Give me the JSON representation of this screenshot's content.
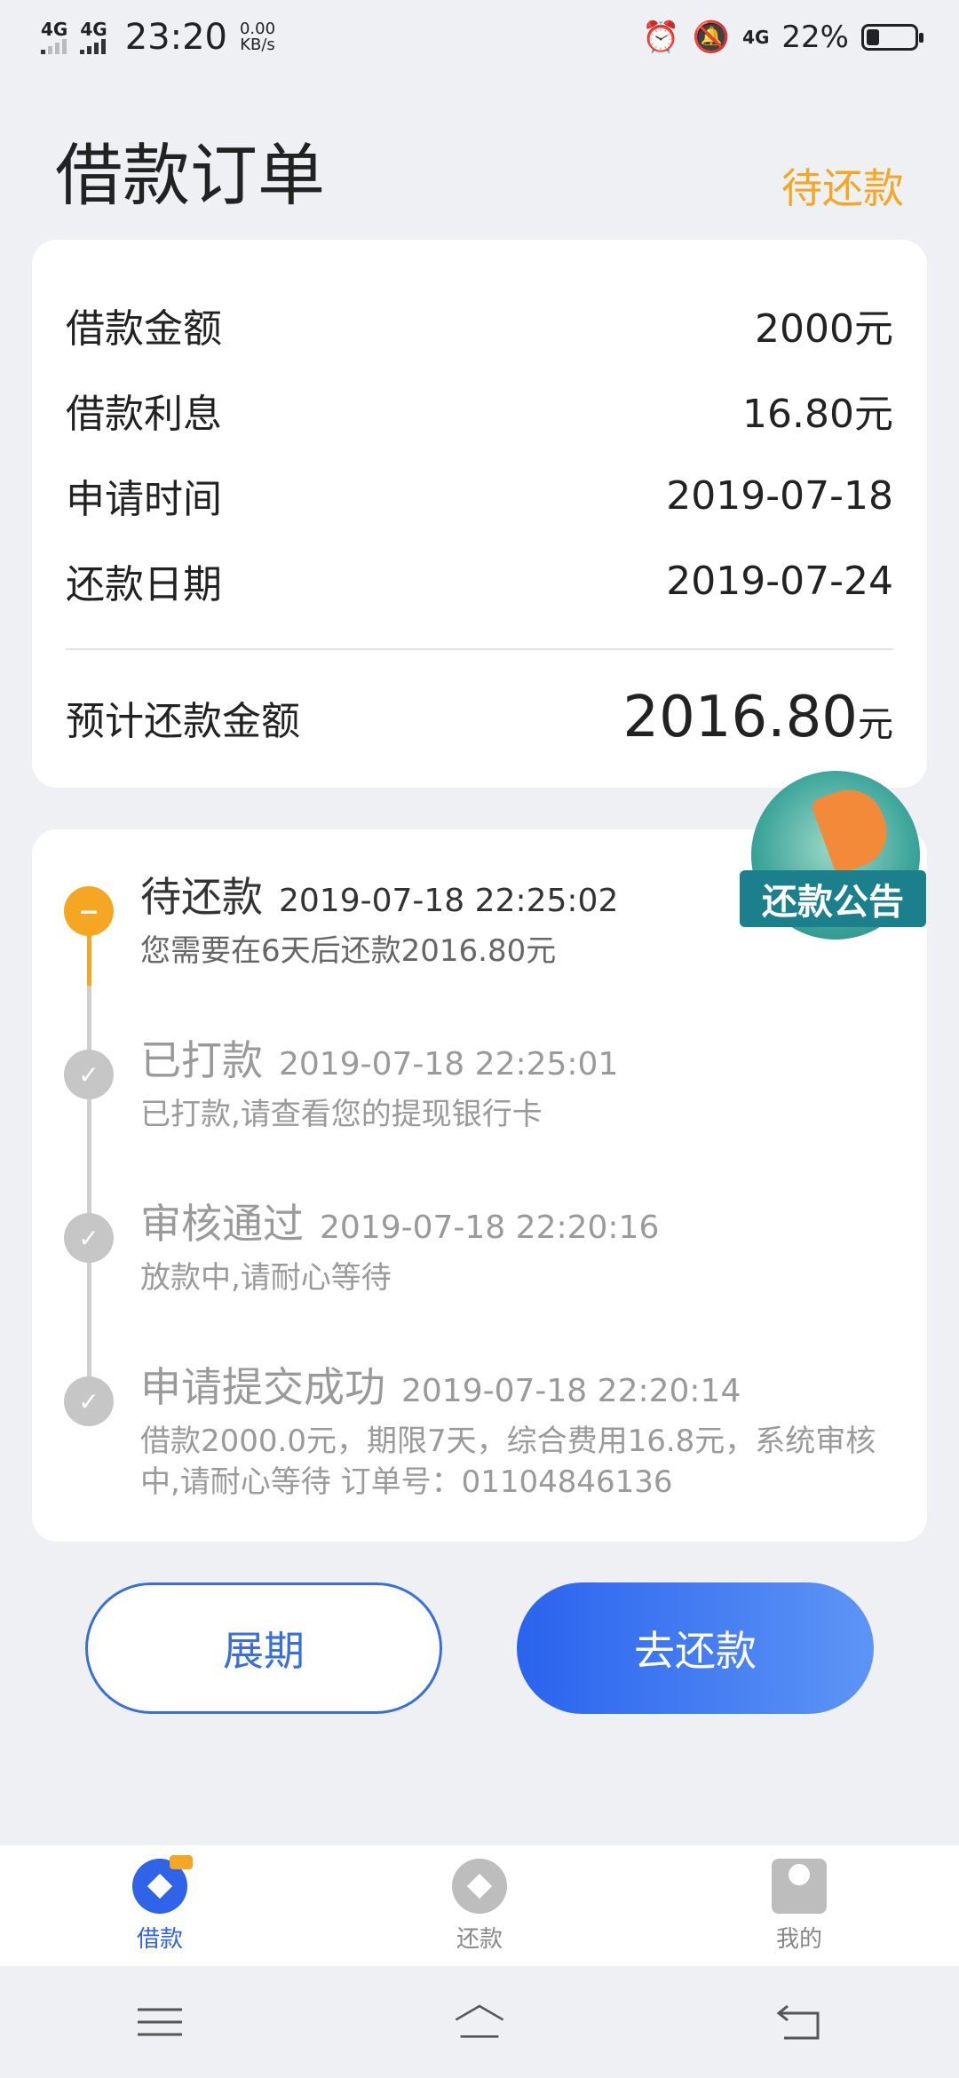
{
  "status_bar": {
    "net1": "4G",
    "net2": "4G",
    "time": "23:20",
    "speed_value": "0.00",
    "speed_unit": "KB/s",
    "net3": "4G",
    "battery": "22%"
  },
  "header": {
    "title": "借款订单",
    "status": "待还款"
  },
  "summary": {
    "rows": [
      {
        "label": "借款金额",
        "value": "2000元"
      },
      {
        "label": "借款利息",
        "value": "16.80元"
      },
      {
        "label": "申请时间",
        "value": "2019-07-18"
      },
      {
        "label": "还款日期",
        "value": "2019-07-24"
      }
    ],
    "total_label": "预计还款金额",
    "total_value": "2016.80",
    "total_unit": "元"
  },
  "notice_badge": {
    "label": "还款公告"
  },
  "timeline": [
    {
      "title": "待还款",
      "time": "2019-07-18 22:25:02",
      "desc": "您需要在6天后还款2016.80元"
    },
    {
      "title": "已打款",
      "time": "2019-07-18 22:25:01",
      "desc": "已打款,请查看您的提现银行卡"
    },
    {
      "title": "审核通过",
      "time": "2019-07-18 22:20:16",
      "desc": "放款中,请耐心等待"
    },
    {
      "title": "申请提交成功",
      "time": "2019-07-18 22:20:14",
      "desc": "借款2000.0元，期限7天，综合费用16.8元，系统审核中,请耐心等待 订单号：01104846136"
    }
  ],
  "buttons": {
    "extend": "展期",
    "repay": "去还款"
  },
  "tabs": [
    {
      "label": "借款",
      "icon": "loan-icon"
    },
    {
      "label": "还款",
      "icon": "repay-icon"
    },
    {
      "label": "我的",
      "icon": "profile-icon"
    }
  ],
  "colors": {
    "accent_orange": "#f5a623",
    "primary_blue": "#2f63e8",
    "background": "#eef0f4"
  }
}
